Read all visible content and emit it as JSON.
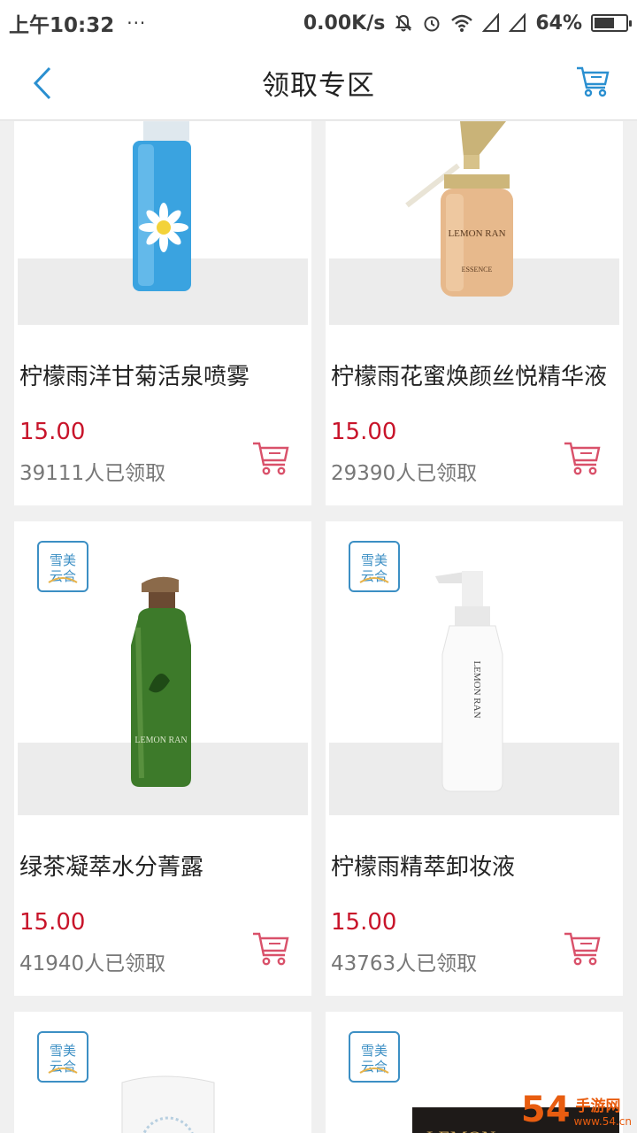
{
  "status_bar": {
    "time": "上午10:32",
    "dots": "···",
    "speed": "0.00K/s",
    "battery": "64%",
    "battery_level": 0.64
  },
  "nav": {
    "title": "领取专区",
    "back_icon": "chevron-left-icon",
    "cart_icon": "cart-icon"
  },
  "colors": {
    "accent": "#2a8fd0",
    "price": "#c8142a",
    "cart_icon": "#d9516a"
  },
  "products": [
    {
      "name": "柠檬雨洋甘菊活泉喷雾",
      "price": "15.00",
      "claimed": "39111人已领取"
    },
    {
      "name": "柠檬雨花蜜焕颜丝悦精华液",
      "price": "15.00",
      "claimed": "29390人已领取"
    },
    {
      "name": "绿茶凝萃水分菁露",
      "price": "15.00",
      "claimed": "41940人已领取"
    },
    {
      "name": "柠檬雨精萃卸妆液",
      "price": "15.00",
      "claimed": "43763人已领取"
    }
  ],
  "watermark": {
    "num": "54",
    "text": "手游网",
    "url": "www.54.cn"
  }
}
